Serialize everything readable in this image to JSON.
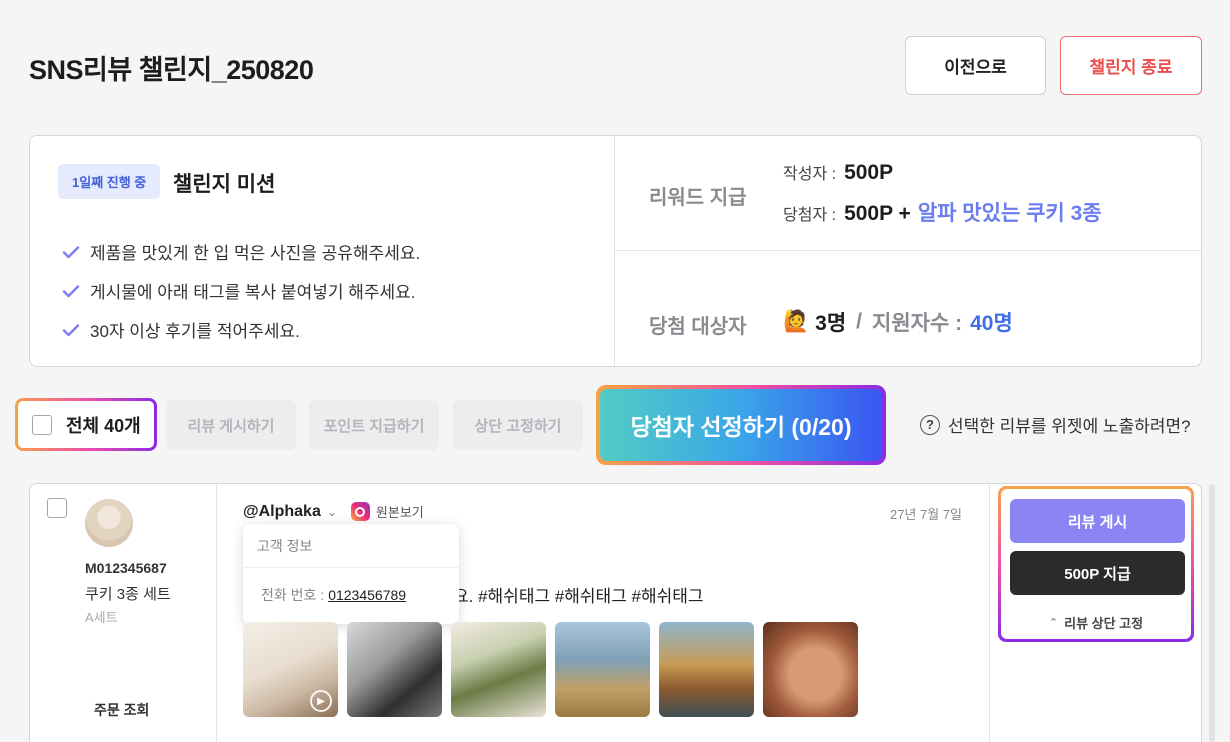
{
  "header": {
    "title": "SNS리뷰 챌린지_250820",
    "prev_label": "이전으로",
    "end_label": "챌린지 종료"
  },
  "mission": {
    "badge": "1일째 진행 중",
    "title": "챌린지 미션",
    "items": [
      "제품을 맛있게 한 입 먹은 사진을 공유해주세요.",
      "게시물에 아래 태그를 복사 붙여넣기 해주세요.",
      "30자 이상 후기를 적어주세요."
    ]
  },
  "reward": {
    "label": "리워드 지급",
    "writer_key": "작성자 :",
    "writer_value": "500P",
    "winner_key": "당첨자 :",
    "winner_value": "500P +",
    "winner_gift": "알파 맛있는 쿠키 3종"
  },
  "winners": {
    "label": "당첨 대상자",
    "emoji": "🙋",
    "count": "3명",
    "slash": "/",
    "applicants_label": "지원자수 :",
    "applicants": "40명"
  },
  "actions": {
    "select_all": "전체 40개",
    "post_reviews": "리뷰 게시하기",
    "pay_points": "포인트 지급하기",
    "pin_top": "상단 고정하기",
    "pick_winners": "당첨자 선정하기 (0/20)",
    "help": "선택한 리뷰를 위젯에 노출하려면?"
  },
  "review": {
    "order_id": "M012345687",
    "product": "쿠키 3종 세트",
    "option": "A세트",
    "order_link": "주문 조회",
    "handle": "@Alphaka",
    "original_link": "원본보기",
    "date": "27년 7월 7일",
    "text": "요. #해쉬태그 #해쉬태그 #해쉬태그",
    "tooltip_title": "고객 정보",
    "tooltip_phone_label": "전화 번호 :",
    "tooltip_phone": "0123456789",
    "post_label": "리뷰 게시",
    "pay_label": "500P 지급",
    "pin_label": "리뷰 상단 고정"
  }
}
